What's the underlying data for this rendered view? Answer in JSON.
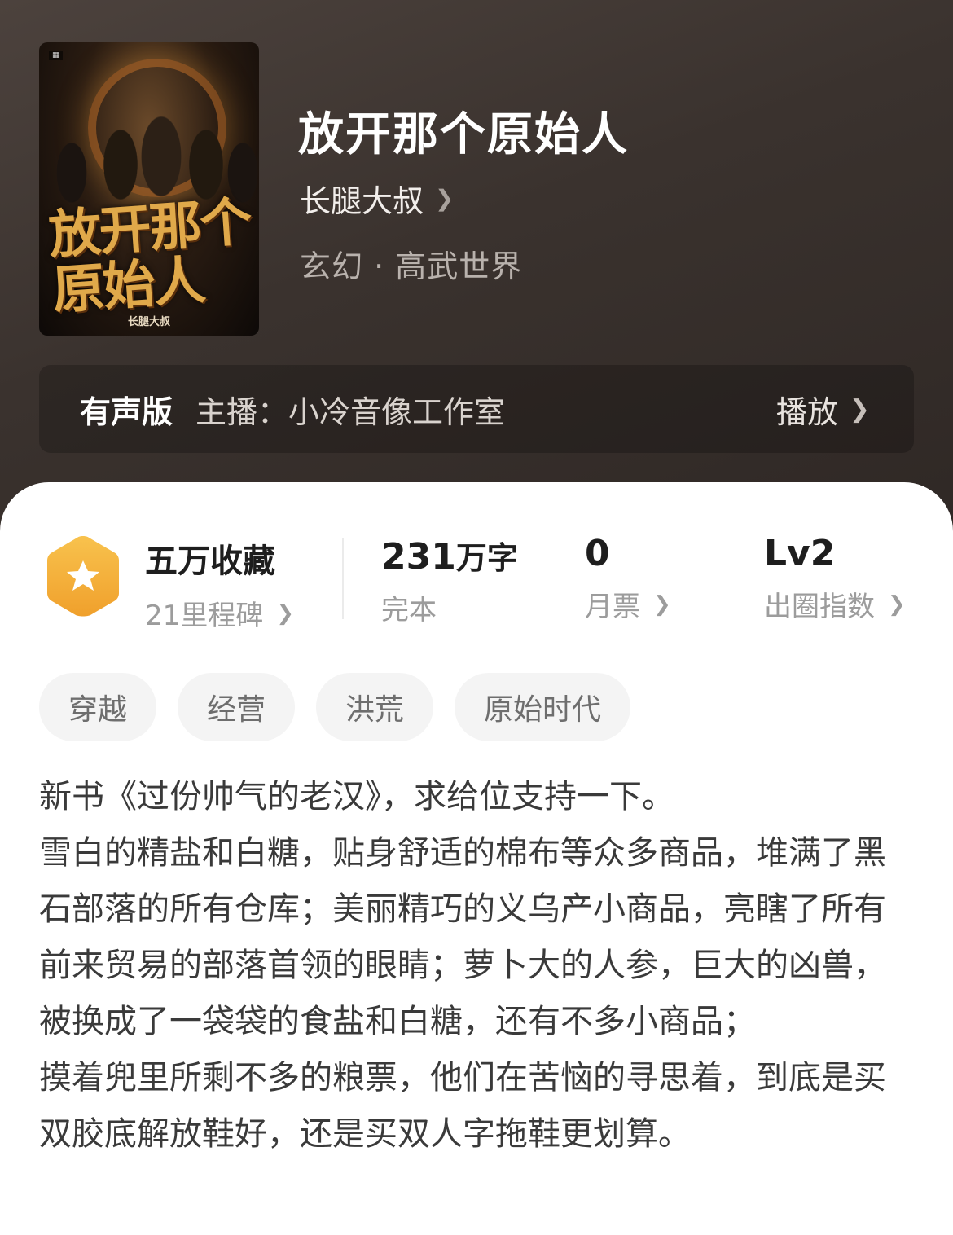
{
  "book": {
    "title": "放开那个原始人",
    "author": "长腿大叔",
    "genre": "玄幻 · 高武世界",
    "cover": {
      "title": "放开那个原始人",
      "author": "长腿大叔"
    }
  },
  "audio": {
    "label": "有声版",
    "narrator": "主播：小冷音像工作室",
    "play_label": "播放"
  },
  "stats": {
    "favorites": {
      "main": "五万收藏",
      "sub": "21里程碑"
    },
    "words": {
      "number": "231",
      "unit": "万字",
      "sub": "完本"
    },
    "monthly_tickets": {
      "main": "0",
      "sub": "月票"
    },
    "popularity": {
      "main": "Lv2",
      "sub": "出圈指数"
    }
  },
  "tags": [
    "穿越",
    "经营",
    "洪荒",
    "原始时代"
  ],
  "description": [
    "新书《过份帅气的老汉》，求给位支持一下。",
    "雪白的精盐和白糖，贴身舒适的棉布等众多商品，堆满了黑石部落的所有仓库；美丽精巧的义乌产小商品，亮瞎了所有前来贸易的部落首领的眼睛；萝卜大的人参，巨大的凶兽，被换成了一袋袋的食盐和白糖，还有不多小商品；",
    "摸着兜里所剩不多的粮票，他们在苦恼的寻思着，到底是买双胶底解放鞋好，还是买双人字拖鞋更划算。"
  ],
  "colors": {
    "hero_bg": "#3a322e",
    "badge": "#f5b13a",
    "tag_bg": "#f4f4f4"
  }
}
